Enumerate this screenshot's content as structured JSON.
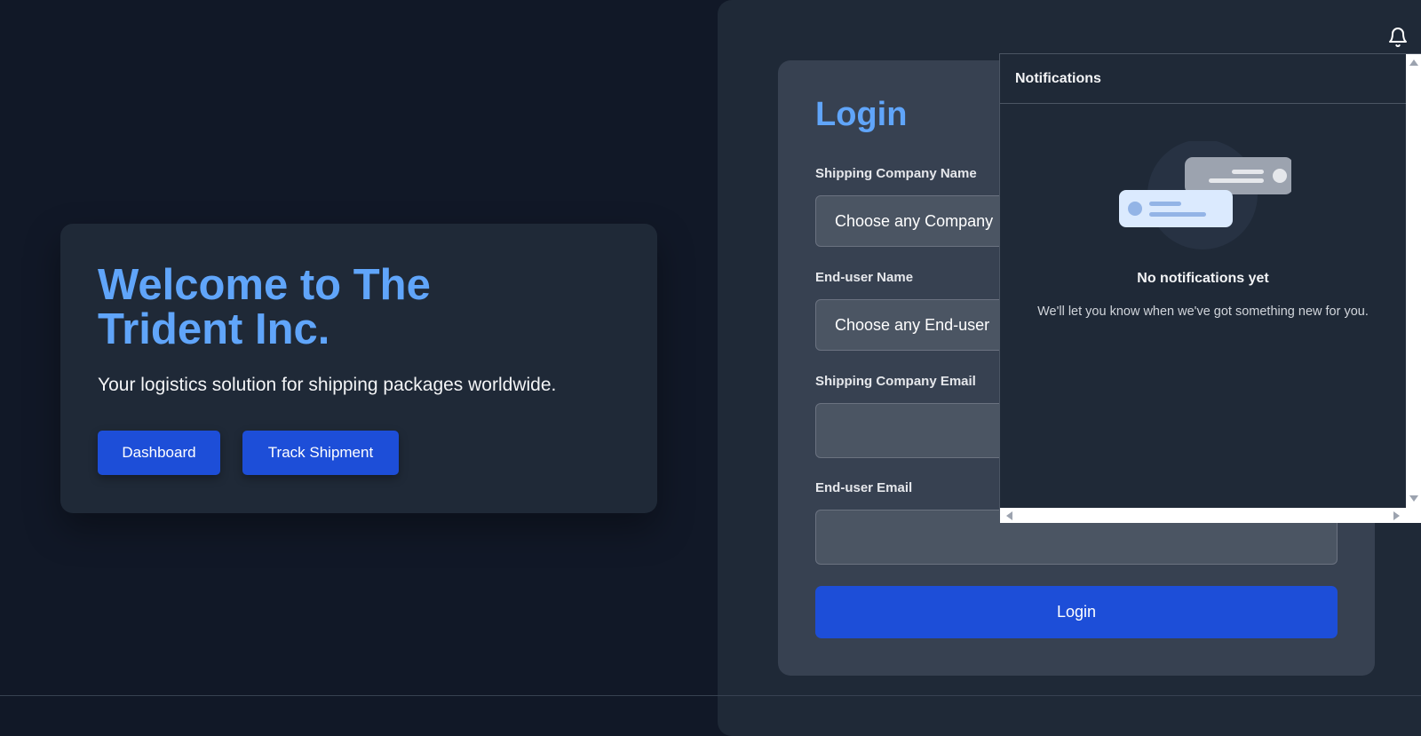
{
  "hero": {
    "title": "Welcome to The Trident Inc.",
    "subtitle": "Your logistics solution for shipping packages worldwide.",
    "dashboard_label": "Dashboard",
    "track_label": "Track Shipment"
  },
  "login": {
    "title": "Login",
    "company_name_label": "Shipping Company Name",
    "company_name_value": "Choose any Company",
    "enduser_name_label": "End-user Name",
    "enduser_name_value": "Choose any End-user",
    "company_email_label": "Shipping Company Email",
    "company_email_value": "",
    "enduser_email_label": "End-user Email",
    "enduser_email_value": "",
    "submit_label": "Login"
  },
  "notifications": {
    "title": "Notifications",
    "empty_title": "No notifications yet",
    "empty_text": "We'll let you know when we've got something new for you.",
    "bell_icon": "bell-icon"
  },
  "colors": {
    "accent": "#60a5fa",
    "primary_button": "#1d4ed8",
    "background": "#111827",
    "card": "#1f2937",
    "login_card": "#374151"
  }
}
